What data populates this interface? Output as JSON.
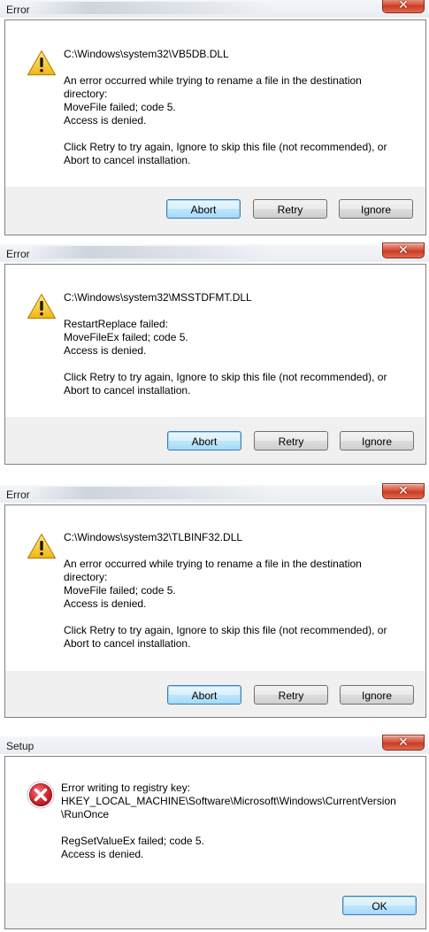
{
  "dialogs": [
    {
      "title": "Error",
      "file": "C:\\Windows\\system32\\VB5DB.DLL",
      "lines": [
        "An error occurred while trying to rename a file in the destination",
        "directory:",
        "MoveFile failed; code 5.",
        "Access is denied."
      ],
      "instructions": [
        "Click Retry to try again, Ignore to skip this file (not recommended), or",
        "Abort to cancel installation."
      ],
      "buttons": {
        "abort": "Abort",
        "retry": "Retry",
        "ignore": "Ignore"
      }
    },
    {
      "title": "Error",
      "file": "C:\\Windows\\system32\\MSSTDFMT.DLL",
      "lines": [
        "RestartReplace failed:",
        "MoveFileEx failed; code 5.",
        "Access is denied."
      ],
      "instructions": [
        "Click Retry to try again, Ignore to skip this file (not recommended), or",
        "Abort to cancel installation."
      ],
      "buttons": {
        "abort": "Abort",
        "retry": "Retry",
        "ignore": "Ignore"
      }
    },
    {
      "title": "Error",
      "file": "C:\\Windows\\system32\\TLBINF32.DLL",
      "lines": [
        "An error occurred while trying to rename a file in the destination",
        "directory:",
        "MoveFile failed; code 5.",
        "Access is denied."
      ],
      "instructions": [
        "Click Retry to try again, Ignore to skip this file (not recommended), or",
        "Abort to cancel installation."
      ],
      "buttons": {
        "abort": "Abort",
        "retry": "Retry",
        "ignore": "Ignore"
      }
    },
    {
      "title": "Setup",
      "lines": [
        "Error writing to registry key:",
        "HKEY_LOCAL_MACHINE\\Software\\Microsoft\\Windows\\CurrentVersion",
        "\\RunOnce"
      ],
      "details": [
        "RegSetValueEx failed; code 5.",
        "Access is denied."
      ],
      "buttons": {
        "ok": "OK"
      }
    }
  ],
  "icons": {
    "warning": "warning-icon",
    "error": "error-icon",
    "close": "close-icon"
  },
  "colors": {
    "close_button": "#d7533c",
    "default_button_border": "#3c7fb1",
    "warning_fill": "#f5c52a",
    "error_fill": "#c8202c"
  }
}
